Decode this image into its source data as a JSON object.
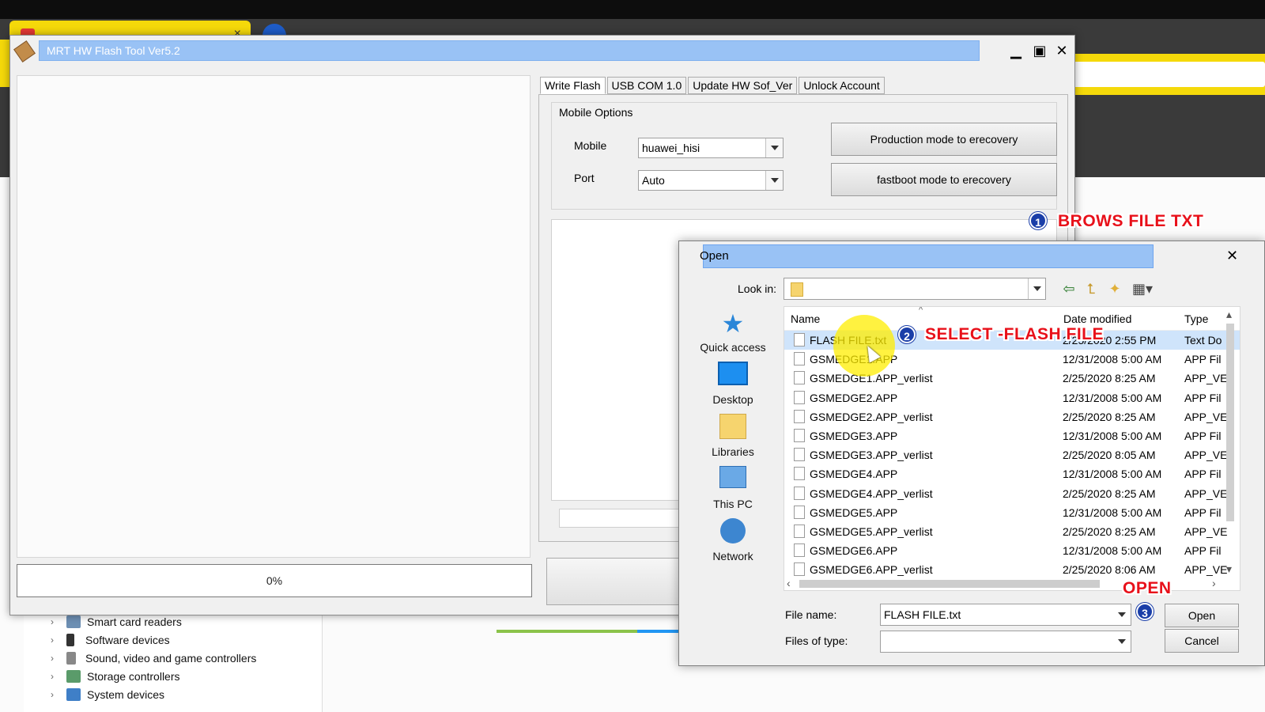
{
  "mrt_window": {
    "title": "MRT HW Flash Tool Ver5.2",
    "progress": "0%",
    "tabs": [
      "Write Flash",
      "USB COM 1.0",
      "Update HW Sof_Ver",
      "Unlock Account"
    ],
    "mobile_options": {
      "group_title": "Mobile Options",
      "mobile_label": "Mobile",
      "mobile_value": "huawei_hisi",
      "port_label": "Port",
      "port_value": "Auto",
      "btn_production": "Production mode to erecovery",
      "btn_fastboot": "fastboot mode to erecovery"
    }
  },
  "device_manager": {
    "items": [
      "Smart card readers",
      "Software devices",
      "Sound, video and game controllers",
      "Storage controllers",
      "System devices"
    ]
  },
  "annotations": {
    "step1_num": "1",
    "step1_text": "BROWS FILE TXT",
    "step2_num": "2",
    "step2_text": "SELECT -FLASH FILE",
    "step3_num": "3",
    "step3_text": "OPEN"
  },
  "open_dialog": {
    "title": "Open",
    "look_in_label": "Look in:",
    "look_in_value": "",
    "places": [
      "Quick access",
      "Desktop",
      "Libraries",
      "This PC",
      "Network"
    ],
    "columns": {
      "name": "Name",
      "date": "Date modified",
      "type": "Type"
    },
    "files": [
      {
        "name": "FLASH FILE.txt",
        "date": "2/25/2020 2:55 PM",
        "type": "Text Do"
      },
      {
        "name": "GSMEDGE1.APP",
        "date": "12/31/2008 5:00 AM",
        "type": "APP Fil"
      },
      {
        "name": "GSMEDGE1.APP_verlist",
        "date": "2/25/2020 8:25 AM",
        "type": "APP_VE"
      },
      {
        "name": "GSMEDGE2.APP",
        "date": "12/31/2008 5:00 AM",
        "type": "APP Fil"
      },
      {
        "name": "GSMEDGE2.APP_verlist",
        "date": "2/25/2020 8:25 AM",
        "type": "APP_VE"
      },
      {
        "name": "GSMEDGE3.APP",
        "date": "12/31/2008 5:00 AM",
        "type": "APP Fil"
      },
      {
        "name": "GSMEDGE3.APP_verlist",
        "date": "2/25/2020 8:05 AM",
        "type": "APP_VE"
      },
      {
        "name": "GSMEDGE4.APP",
        "date": "12/31/2008 5:00 AM",
        "type": "APP Fil"
      },
      {
        "name": "GSMEDGE4.APP_verlist",
        "date": "2/25/2020 8:25 AM",
        "type": "APP_VE"
      },
      {
        "name": "GSMEDGE5.APP",
        "date": "12/31/2008 5:00 AM",
        "type": "APP Fil"
      },
      {
        "name": "GSMEDGE5.APP_verlist",
        "date": "2/25/2020 8:25 AM",
        "type": "APP_VE"
      },
      {
        "name": "GSMEDGE6.APP",
        "date": "12/31/2008 5:00 AM",
        "type": "APP Fil"
      },
      {
        "name": "GSMEDGE6.APP_verlist",
        "date": "2/25/2020 8:06 AM",
        "type": "APP_VE"
      }
    ],
    "file_name_label": "File name:",
    "file_name_value": "FLASH FILE.txt",
    "files_of_type_label": "Files of type:",
    "files_of_type_value": "",
    "open_button": "Open",
    "cancel_button": "Cancel"
  },
  "colors": {
    "title_highlight": "#99c2f5",
    "annotation_red": "#e8101a",
    "step_badge": "#1a3ea8",
    "cursor_highlight": "#ffee00"
  }
}
